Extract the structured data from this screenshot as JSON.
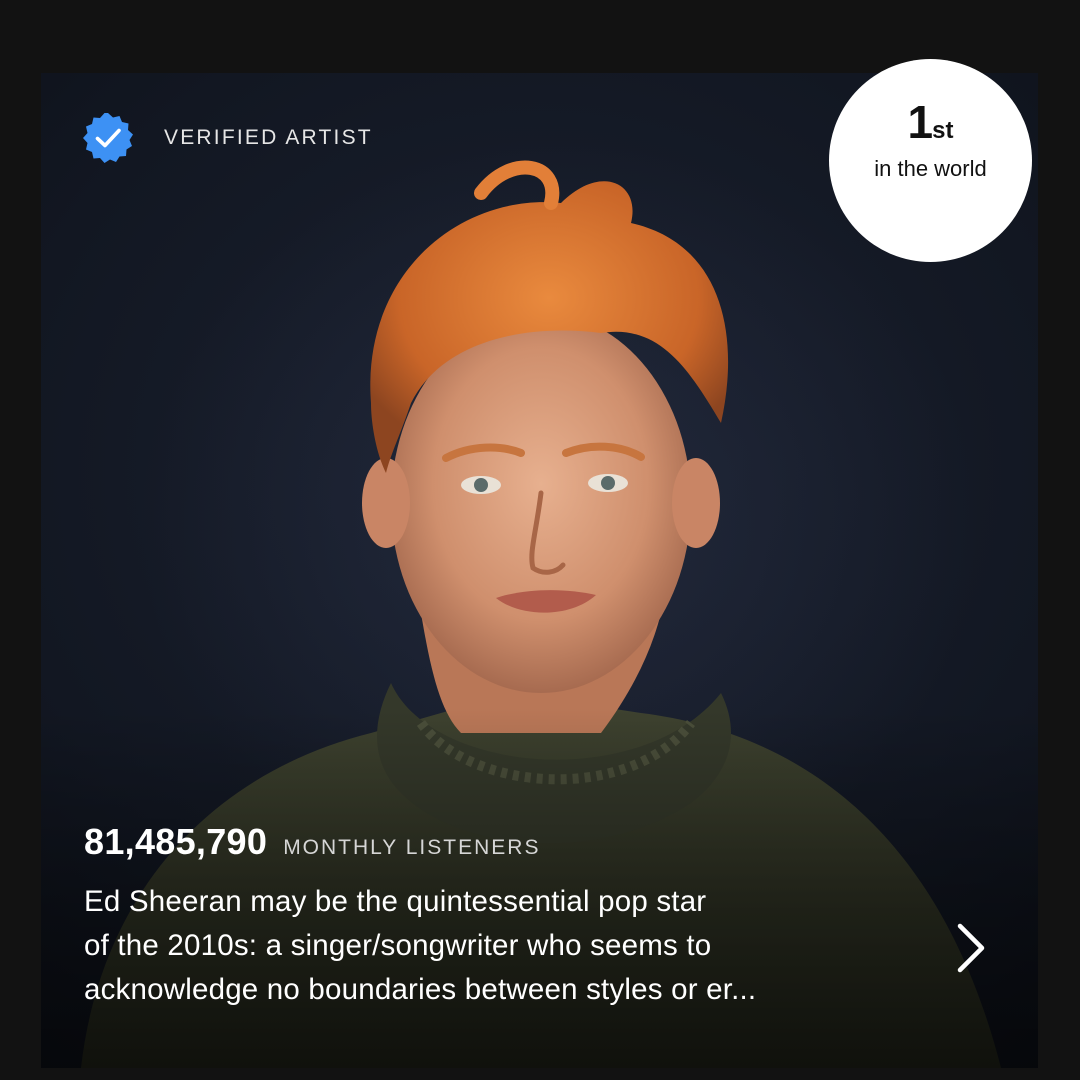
{
  "artist_card": {
    "verified_label": "VERIFIED ARTIST",
    "rank": {
      "number": "1",
      "suffix": "st",
      "caption": "in the world"
    },
    "monthly_listeners": {
      "count": "81,485,790",
      "label": "MONTHLY LISTENERS"
    },
    "bio_lines": [
      "Ed Sheeran may be the quintessential pop star",
      "of the 2010s: a singer/songwriter who seems to",
      "acknowledge no boundaries between styles or er..."
    ],
    "icons": {
      "verified": "verified-badge-icon",
      "expand": "chevron-right-icon"
    },
    "colors": {
      "verified_badge": "#3d91f4",
      "rank_circle": "#ffffff",
      "page_background": "#121212"
    }
  }
}
